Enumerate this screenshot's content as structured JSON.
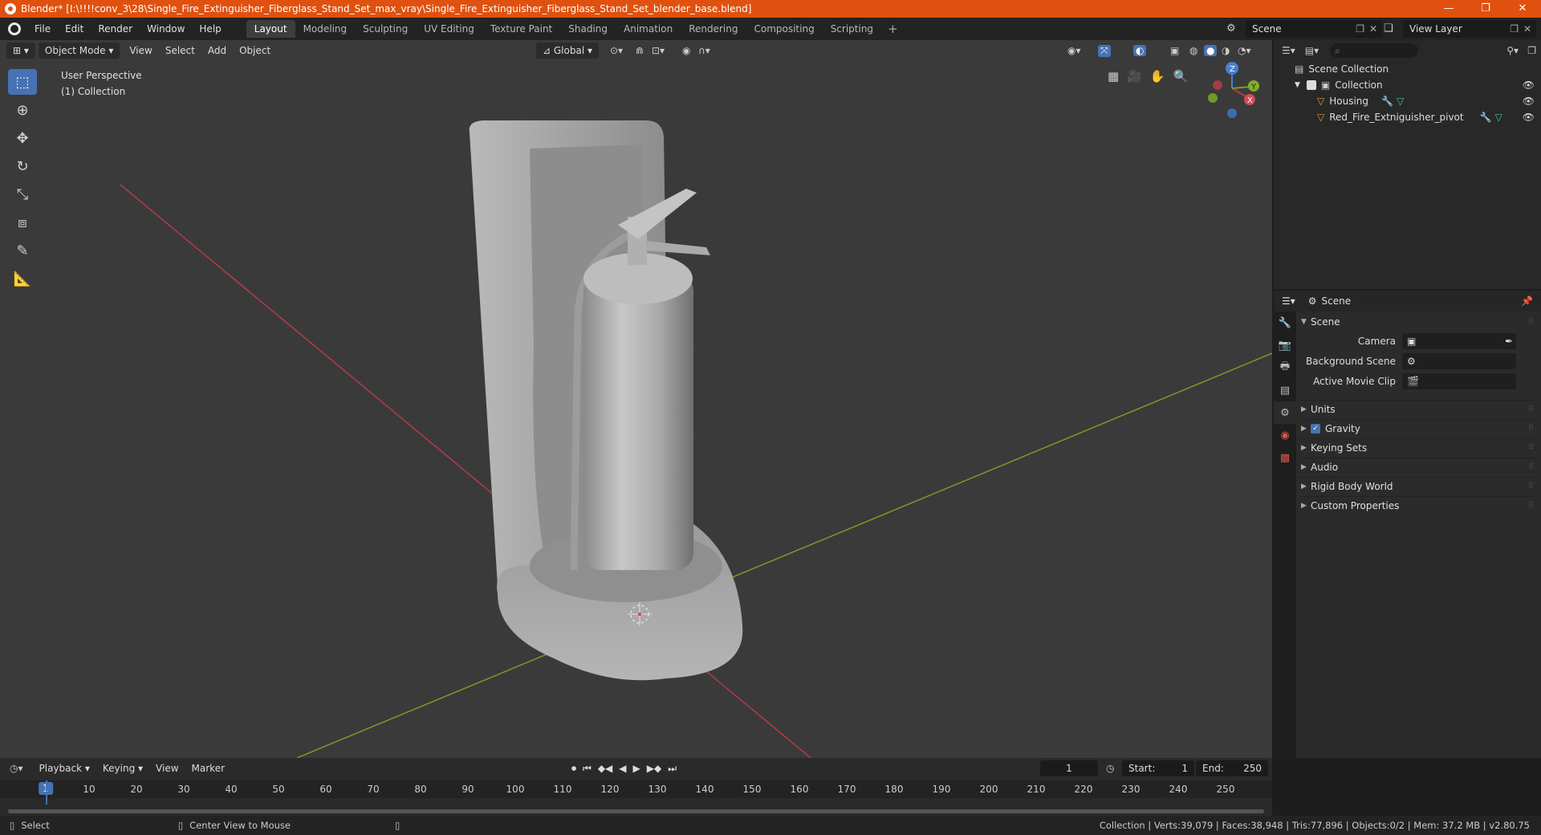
{
  "titlebar": {
    "title": "Blender* [I:\\!!!!conv_3\\28\\Single_Fire_Extinguisher_Fiberglass_Stand_Set_max_vray\\Single_Fire_Extinguisher_Fiberglass_Stand_Set_blender_base.blend]",
    "minimize": "—",
    "maximize": "❐",
    "close": "✕"
  },
  "menubar": {
    "items": [
      "File",
      "Edit",
      "Render",
      "Window",
      "Help"
    ],
    "workspaces": [
      "Layout",
      "Modeling",
      "Sculpting",
      "UV Editing",
      "Texture Paint",
      "Shading",
      "Animation",
      "Rendering",
      "Compositing",
      "Scripting"
    ],
    "active_workspace": "Layout",
    "add_workspace": "+",
    "scene": "Scene",
    "view_layer": "View Layer"
  },
  "viewport": {
    "mode": "Object Mode",
    "menus": [
      "View",
      "Select",
      "Add",
      "Object"
    ],
    "transform": "Global",
    "perspective_label": "User Perspective",
    "collection_label": "(1) Collection",
    "gizmo": {
      "x": "X",
      "y": "Y",
      "z": "Z"
    }
  },
  "outliner": {
    "root": "Scene Collection",
    "collection": "Collection",
    "objects": [
      "Housing",
      "Red_Fire_Extniguisher_pivot"
    ]
  },
  "properties": {
    "header": "Scene",
    "section": "Scene",
    "fields": [
      {
        "label": "Camera",
        "value": ""
      },
      {
        "label": "Background Scene",
        "value": ""
      },
      {
        "label": "Active Movie Clip",
        "value": ""
      }
    ],
    "panels": [
      "Units",
      "Gravity",
      "Keying Sets",
      "Audio",
      "Rigid Body World",
      "Custom Properties"
    ]
  },
  "timeline": {
    "menus": [
      "Playback",
      "Keying",
      "View",
      "Marker"
    ],
    "current_frame": "1",
    "start_label": "Start:",
    "start": "1",
    "end_label": "End:",
    "end": "250",
    "ticks": [
      "10",
      "20",
      "30",
      "40",
      "50",
      "60",
      "70",
      "80",
      "90",
      "100",
      "110",
      "120",
      "130",
      "140",
      "150",
      "160",
      "170",
      "180",
      "190",
      "200",
      "210",
      "220",
      "230",
      "240",
      "250"
    ],
    "cursor_label": "1"
  },
  "statusbar": {
    "select": "Select",
    "center": "Center View to Mouse",
    "stats": "Collection | Verts:39,079 | Faces:38,948 | Tris:77,896 | Objects:0/2 | Mem: 37.2 MB | v2.80.75"
  },
  "colors": {
    "title_bar": "#e0510f",
    "accent": "#4772b3",
    "x_axis": "#b83a48",
    "y_axis": "#7a9b27"
  }
}
